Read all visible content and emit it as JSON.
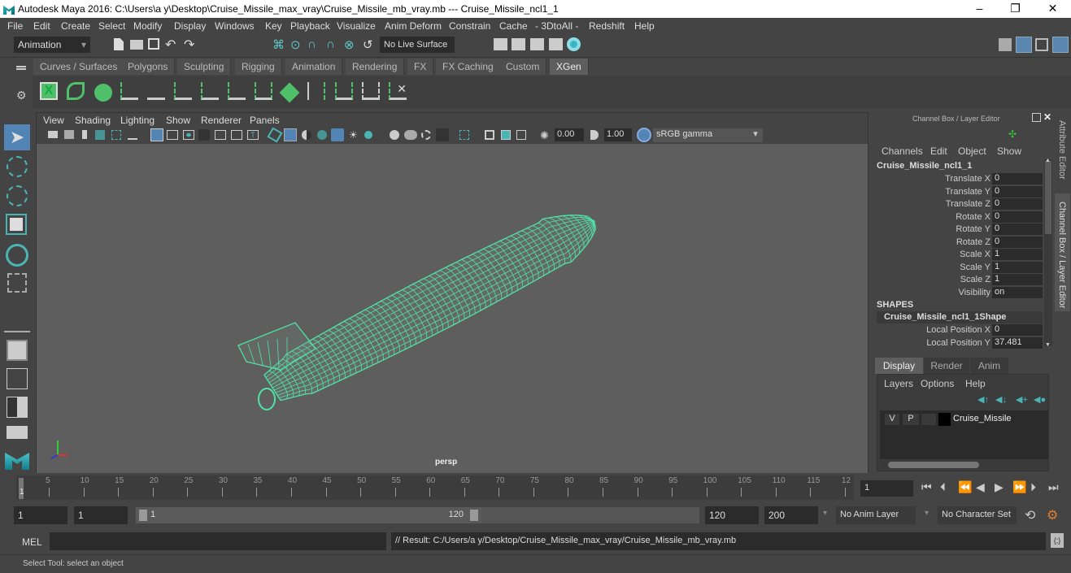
{
  "window": {
    "title": "Autodesk Maya 2016: C:\\Users\\a y\\Desktop\\Cruise_Missile_max_vray\\Cruise_Missile_mb_vray.mb   ---   Cruise_Missile_ncl1_1",
    "minimize": "–",
    "maximize": "❐",
    "close": "✕"
  },
  "menubar": [
    "File",
    "Edit",
    "Create",
    "Select",
    "Modify",
    "Display",
    "Windows",
    "Key",
    "Playback",
    "Visualize",
    "Anim Deform",
    "Constrain",
    "Cache",
    "- 3DtoAll -",
    "Redshift",
    "Help"
  ],
  "statusline": {
    "menuset": "Animation",
    "live_surface": "No Live Surface"
  },
  "shelf": {
    "tabs": [
      "Curves / Surfaces",
      "Polygons",
      "Sculpting",
      "Rigging",
      "Animation",
      "Rendering",
      "FX",
      "FX Caching",
      "Custom",
      "XGen"
    ],
    "active_tab": "XGen",
    "icons": [
      "xgen-editor-icon",
      "create-description-icon",
      "toggle-preview-icon",
      "add-guides-icon",
      "place-guides-icon",
      "add-guide-icon",
      "guide-sculpt-icon",
      "lock-guide-icon",
      "rebuild-guide-icon",
      "create-patch-icon",
      "guide-length-icon",
      "cut-guides-icon",
      "select-guides-icon",
      "delete-guides-icon"
    ]
  },
  "viewport": {
    "menu": [
      "View",
      "Shading",
      "Lighting",
      "Show",
      "Renderer",
      "Panels"
    ],
    "exposure": "0.00",
    "gamma": "1.00",
    "colorspace": "sRGB gamma",
    "camera_label": "persp",
    "wire_color": "#4fe3a8"
  },
  "channelbox": {
    "header": "Channel Box / Layer Editor",
    "menu": [
      "Channels",
      "Edit",
      "Object",
      "Show"
    ],
    "object": "Cruise_Missile_ncl1_1",
    "channels": [
      {
        "label": "Translate X",
        "value": "0"
      },
      {
        "label": "Translate Y",
        "value": "0"
      },
      {
        "label": "Translate Z",
        "value": "0"
      },
      {
        "label": "Rotate X",
        "value": "0"
      },
      {
        "label": "Rotate Y",
        "value": "0"
      },
      {
        "label": "Rotate Z",
        "value": "0"
      },
      {
        "label": "Scale X",
        "value": "1"
      },
      {
        "label": "Scale Y",
        "value": "1"
      },
      {
        "label": "Scale Z",
        "value": "1"
      },
      {
        "label": "Visibility",
        "value": "on"
      }
    ],
    "shapes_header": "SHAPES",
    "shape_name": "Cruise_Missile_ncl1_1Shape",
    "shape_channels": [
      {
        "label": "Local Position X",
        "value": "0"
      },
      {
        "label": "Local Position Y",
        "value": "37.481"
      }
    ]
  },
  "layers": {
    "tabs": [
      "Display",
      "Render",
      "Anim"
    ],
    "active_tab": "Display",
    "menu": [
      "Layers",
      "Options",
      "Help"
    ],
    "items": [
      {
        "v": "V",
        "p": "P",
        "name": "Cruise_Missile",
        "color": "#000000"
      }
    ]
  },
  "sidetabs": [
    "Attribute Editor",
    "Channel Box / Layer Editor"
  ],
  "timeline": {
    "ticks": [
      "5",
      "10",
      "15",
      "20",
      "25",
      "30",
      "35",
      "40",
      "45",
      "50",
      "55",
      "60",
      "65",
      "70",
      "75",
      "80",
      "85",
      "90",
      "95",
      "100",
      "105",
      "110",
      "115",
      "12"
    ],
    "current_marker": "1",
    "current_frame": "1"
  },
  "range": {
    "start": "1",
    "playback_start": "1",
    "slider_start": "1",
    "slider_end": "120",
    "playback_end": "120",
    "end": "200",
    "anim_layer": "No Anim Layer",
    "character_set": "No Character Set"
  },
  "cmdline": {
    "label": "MEL",
    "input": "",
    "result": "// Result: C:/Users/a y/Desktop/Cruise_Missile_max_vray/Cruise_Missile_mb_vray.mb"
  },
  "helpline": "Select Tool: select an object"
}
